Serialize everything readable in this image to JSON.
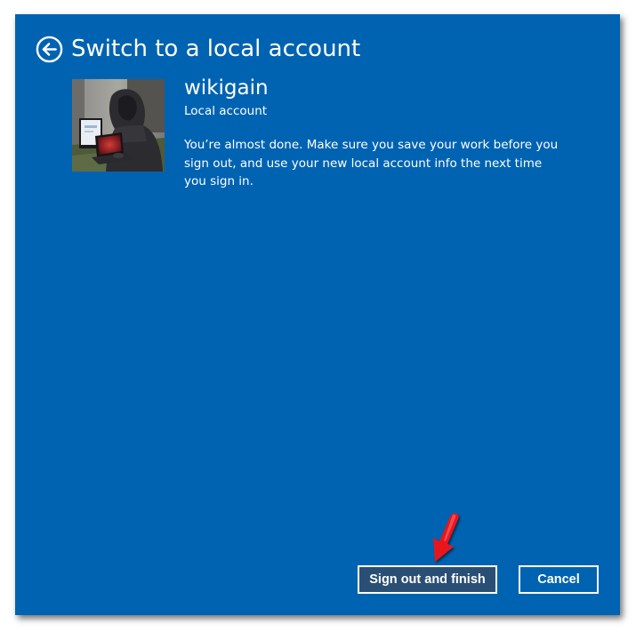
{
  "dialog": {
    "title": "Switch to a local account",
    "back_icon": "back-arrow-icon",
    "background_color": "#0063b1"
  },
  "account": {
    "username": "wikigain",
    "account_type": "Local account",
    "avatar": "user-photo"
  },
  "message": "You’re almost done. Make sure you save your work before you sign out, and use your new local account info the next time you sign in.",
  "buttons": {
    "primary_label": "Sign out and finish",
    "primary_color": "#2a4f75",
    "cancel_label": "Cancel"
  },
  "annotation": {
    "icon": "red-pointer-arrow-icon",
    "color": "#e8151b"
  }
}
